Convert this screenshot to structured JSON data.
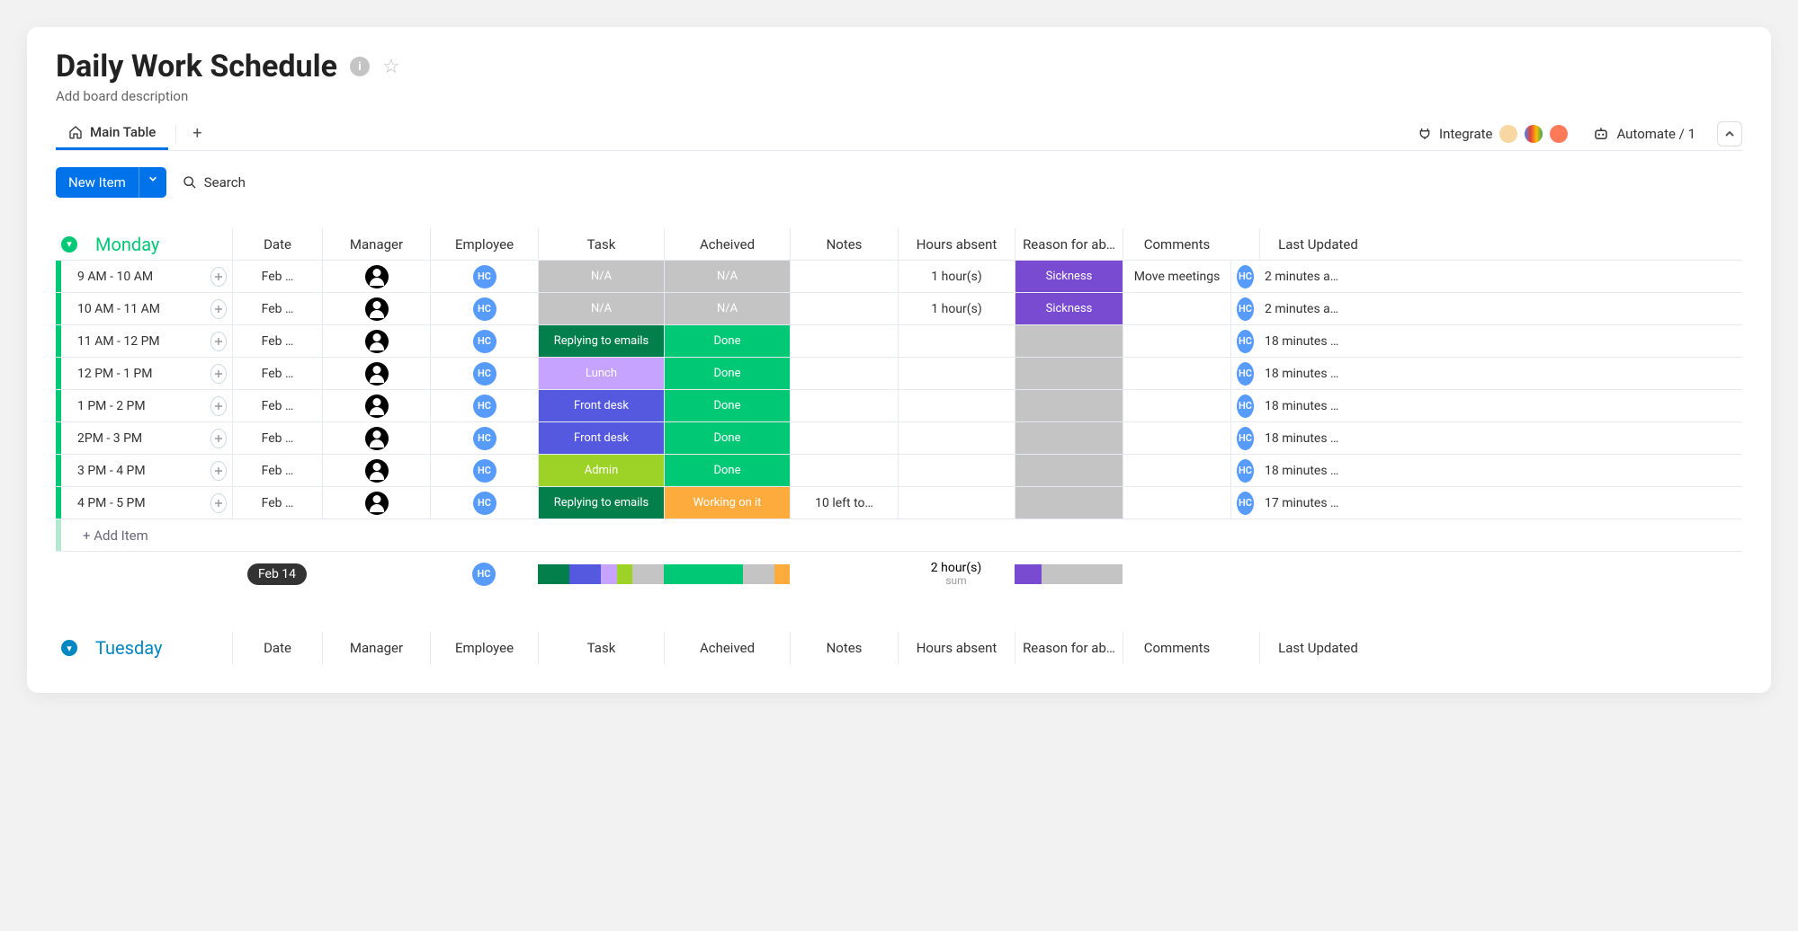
{
  "title": "Daily Work Schedule",
  "description_placeholder": "Add board description",
  "tabs": {
    "main": "Main Table"
  },
  "topbar": {
    "integrate": "Integrate",
    "automate": "Automate / 1"
  },
  "actions": {
    "new_item": "New Item",
    "search": "Search"
  },
  "columns": [
    "Date",
    "Manager",
    "Employee",
    "Task",
    "Acheived",
    "Notes",
    "Hours absent",
    "Reason for ab…",
    "Comments",
    "Last Updated"
  ],
  "groups": {
    "monday": {
      "name": "Monday",
      "color": "#00c875",
      "rows": [
        {
          "name": "9 AM - 10 AM",
          "date": "Feb …",
          "employee": "HC",
          "task": {
            "label": "N/A",
            "color": "c-gray"
          },
          "achieved": {
            "label": "N/A",
            "color": "c-gray"
          },
          "notes": "",
          "hours": "1 hour(s)",
          "reason": {
            "label": "Sickness",
            "color": "c-purple"
          },
          "comments": "Move meetings",
          "updated": "2 minutes a…"
        },
        {
          "name": "10 AM - 11 AM",
          "date": "Feb …",
          "employee": "HC",
          "task": {
            "label": "N/A",
            "color": "c-gray"
          },
          "achieved": {
            "label": "N/A",
            "color": "c-gray"
          },
          "notes": "",
          "hours": "1 hour(s)",
          "reason": {
            "label": "Sickness",
            "color": "c-purple"
          },
          "comments": "",
          "updated": "2 minutes a…"
        },
        {
          "name": "11 AM - 12 PM",
          "date": "Feb …",
          "employee": "HC",
          "task": {
            "label": "Replying to emails",
            "color": "c-dkgreen"
          },
          "achieved": {
            "label": "Done",
            "color": "c-green"
          },
          "notes": "",
          "hours": "",
          "reason": {
            "label": "",
            "color": "c-gray"
          },
          "comments": "",
          "updated": "18 minutes …"
        },
        {
          "name": "12 PM - 1 PM",
          "date": "Feb …",
          "employee": "HC",
          "task": {
            "label": "Lunch",
            "color": "c-lilac2"
          },
          "achieved": {
            "label": "Done",
            "color": "c-green"
          },
          "notes": "",
          "hours": "",
          "reason": {
            "label": "",
            "color": "c-gray"
          },
          "comments": "",
          "updated": "18 minutes …"
        },
        {
          "name": "1 PM - 2 PM",
          "date": "Feb …",
          "employee": "HC",
          "task": {
            "label": "Front desk",
            "color": "c-blue"
          },
          "achieved": {
            "label": "Done",
            "color": "c-green"
          },
          "notes": "",
          "hours": "",
          "reason": {
            "label": "",
            "color": "c-gray"
          },
          "comments": "",
          "updated": "18 minutes …"
        },
        {
          "name": "2PM - 3 PM",
          "date": "Feb …",
          "employee": "HC",
          "task": {
            "label": "Front desk",
            "color": "c-blue"
          },
          "achieved": {
            "label": "Done",
            "color": "c-green"
          },
          "notes": "",
          "hours": "",
          "reason": {
            "label": "",
            "color": "c-gray"
          },
          "comments": "",
          "updated": "18 minutes …"
        },
        {
          "name": "3 PM - 4 PM",
          "date": "Feb …",
          "employee": "HC",
          "task": {
            "label": "Admin",
            "color": "c-lime"
          },
          "achieved": {
            "label": "Done",
            "color": "c-green"
          },
          "notes": "",
          "hours": "",
          "reason": {
            "label": "",
            "color": "c-gray"
          },
          "comments": "",
          "updated": "18 minutes …"
        },
        {
          "name": "4 PM - 5 PM",
          "date": "Feb …",
          "employee": "HC",
          "task": {
            "label": "Replying to emails",
            "color": "c-dkgreen"
          },
          "achieved": {
            "label": "Working on it",
            "color": "c-orange"
          },
          "notes": "10 left to…",
          "hours": "",
          "reason": {
            "label": "",
            "color": "c-gray"
          },
          "comments": "",
          "updated": "17 minutes …"
        }
      ],
      "add_item": "+ Add Item",
      "summary": {
        "date_pill": "Feb 14",
        "employee": "HC",
        "hours": "2 hour(s)",
        "hours_sub": "sum"
      }
    },
    "tuesday": {
      "name": "Tuesday",
      "color": "#0086c0"
    }
  }
}
